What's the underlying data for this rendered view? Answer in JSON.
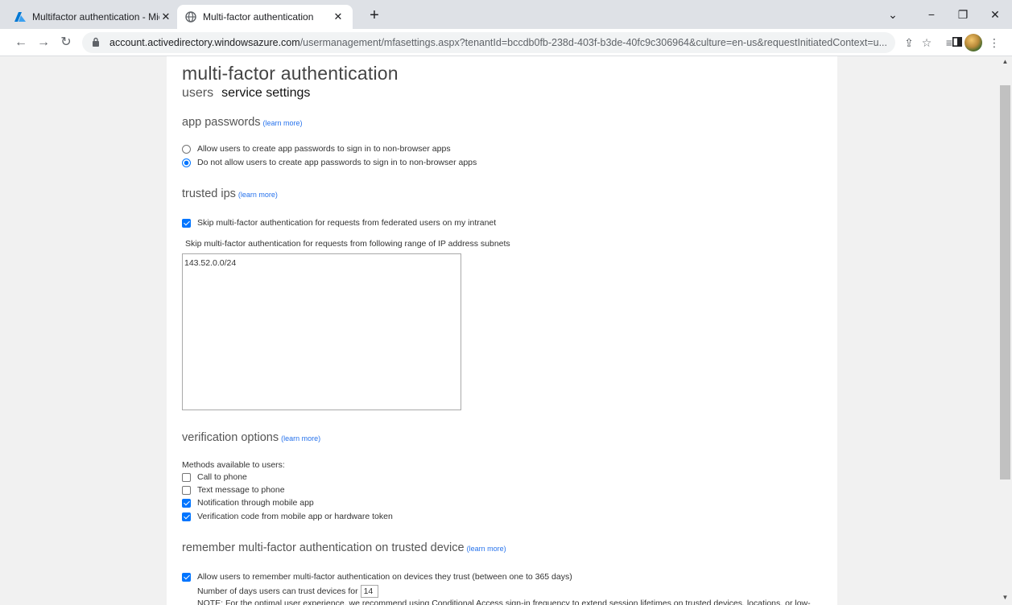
{
  "browser": {
    "tabs": [
      {
        "title": "Multifactor authentication - Micr",
        "active": false
      },
      {
        "title": "Multi-factor authentication",
        "active": true
      }
    ],
    "url_host": "account.activedirectory.windowsazure.com",
    "url_path": "/usermanagement/mfasettings.aspx?tenantId=bccdb0fb-238d-403f-b3de-40fc9c306964&culture=en-us&requestInitiatedContext=u...",
    "colors": {
      "tabbar": "#dee1e6",
      "accent": "#0075ff",
      "azure": "#0078d4"
    }
  },
  "page": {
    "title": "multi-factor authentication",
    "nav": {
      "users": "users",
      "service_settings": "service settings"
    },
    "learn_more": "(learn more)",
    "app_passwords": {
      "heading": "app passwords",
      "allow": "Allow users to create app passwords to sign in to non-browser apps",
      "deny": "Do not allow users to create app passwords to sign in to non-browser apps",
      "selected": "deny"
    },
    "trusted_ips": {
      "heading": "trusted ips",
      "skip_federated": "Skip multi-factor authentication for requests from federated users on my intranet",
      "skip_federated_checked": true,
      "subnets_label": "Skip multi-factor authentication for requests from following range of IP address subnets",
      "subnets_value": "143.52.0.0/24"
    },
    "verification": {
      "heading": "verification options",
      "methods_label": "Methods available to users:",
      "methods": [
        {
          "label": "Call to phone",
          "checked": false
        },
        {
          "label": "Text message to phone",
          "checked": false
        },
        {
          "label": "Notification through mobile app",
          "checked": true
        },
        {
          "label": "Verification code from mobile app or hardware token",
          "checked": true
        }
      ]
    },
    "remember": {
      "heading": "remember multi-factor authentication on trusted device",
      "allow": "Allow users to remember multi-factor authentication on devices they trust (between one to 365 days)",
      "allow_checked": true,
      "days_label": "Number of days users can trust devices for",
      "days_value": "14",
      "note": "NOTE: For the optimal user experience, we recommend using Conditional Access sign-in frequency to extend session lifetimes on trusted devices, locations, or low-"
    }
  }
}
